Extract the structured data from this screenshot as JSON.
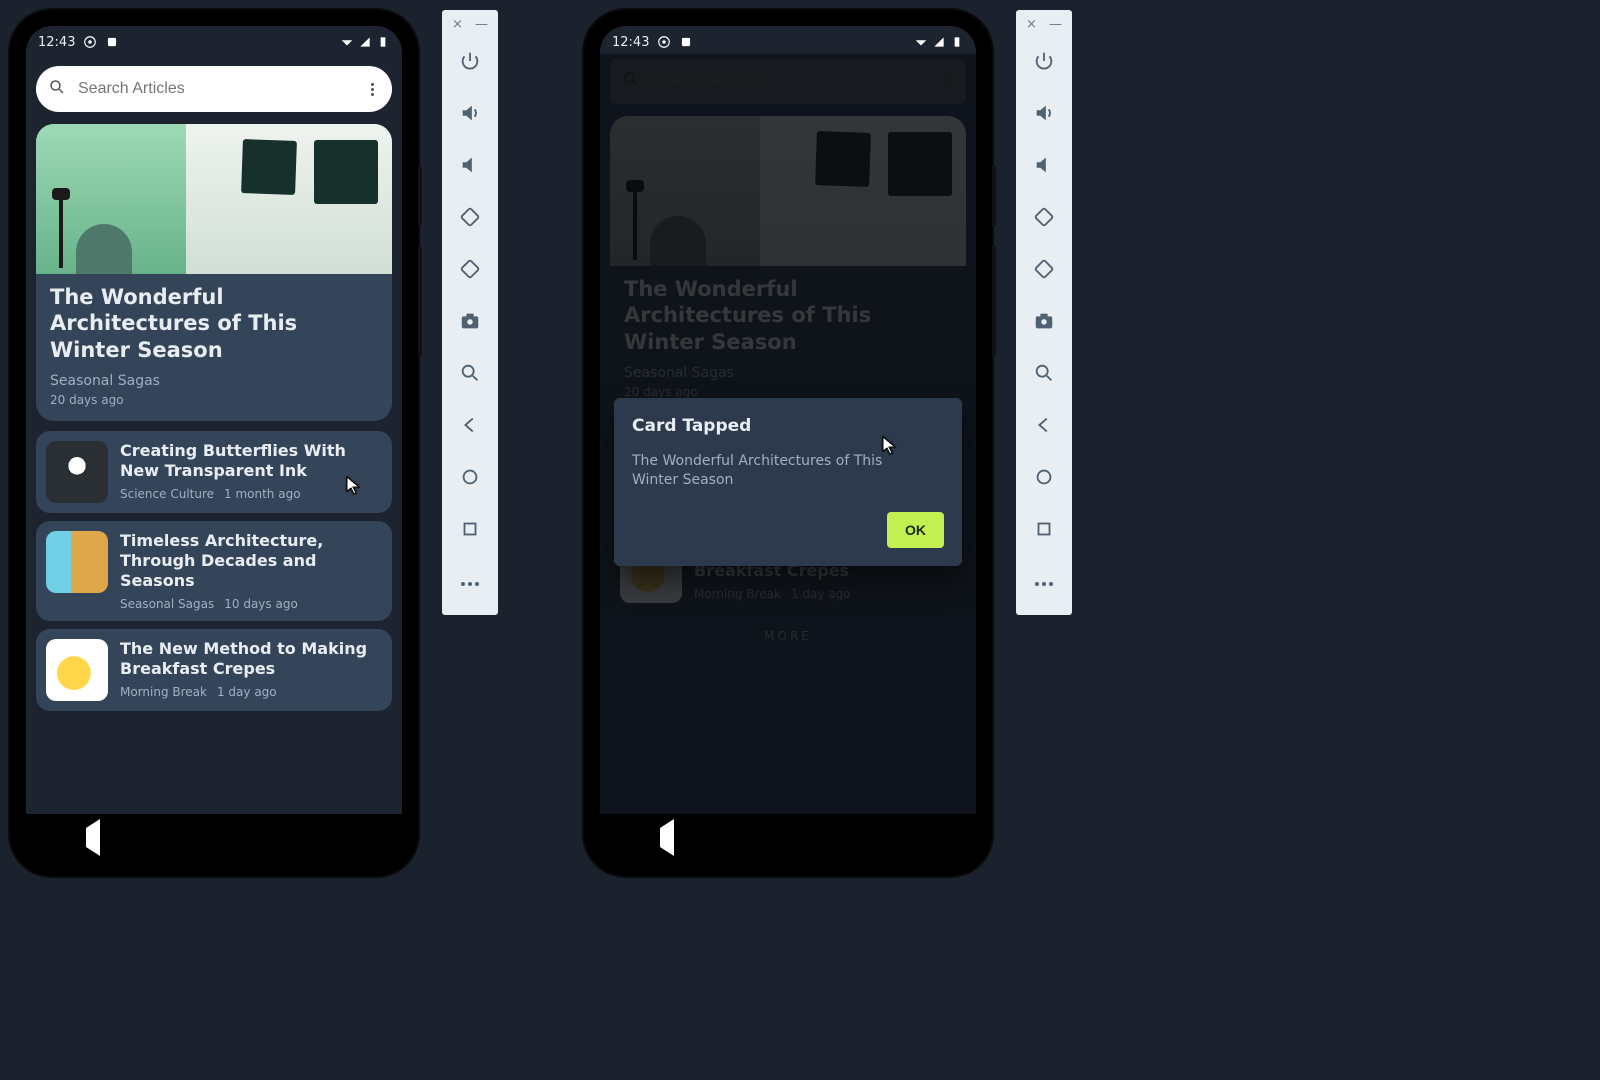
{
  "statusbar": {
    "time": "12:43"
  },
  "search": {
    "placeholder": "Search Articles"
  },
  "hero": {
    "title": "The Wonderful Architectures of This Winter Season",
    "source": "Seasonal Sagas",
    "age": "20 days ago"
  },
  "articles": [
    {
      "title": "Creating Butterflies With New Transparent Ink",
      "source": "Science Culture",
      "age": "1 month ago"
    },
    {
      "title": "Timeless Architecture, Through Decades and Seasons",
      "source": "Seasonal Sagas",
      "age": "10 days ago"
    },
    {
      "title": "The New Method to Making Breakfast Crepes",
      "source": "Morning Break",
      "age": "1 day ago"
    }
  ],
  "dialog": {
    "title": "Card Tapped",
    "body": "The Wonderful Architectures of This Winter Season",
    "ok": "OK"
  },
  "misc": {
    "more": "MORE"
  },
  "toolbar": {
    "close": "×",
    "minimize": "—"
  }
}
